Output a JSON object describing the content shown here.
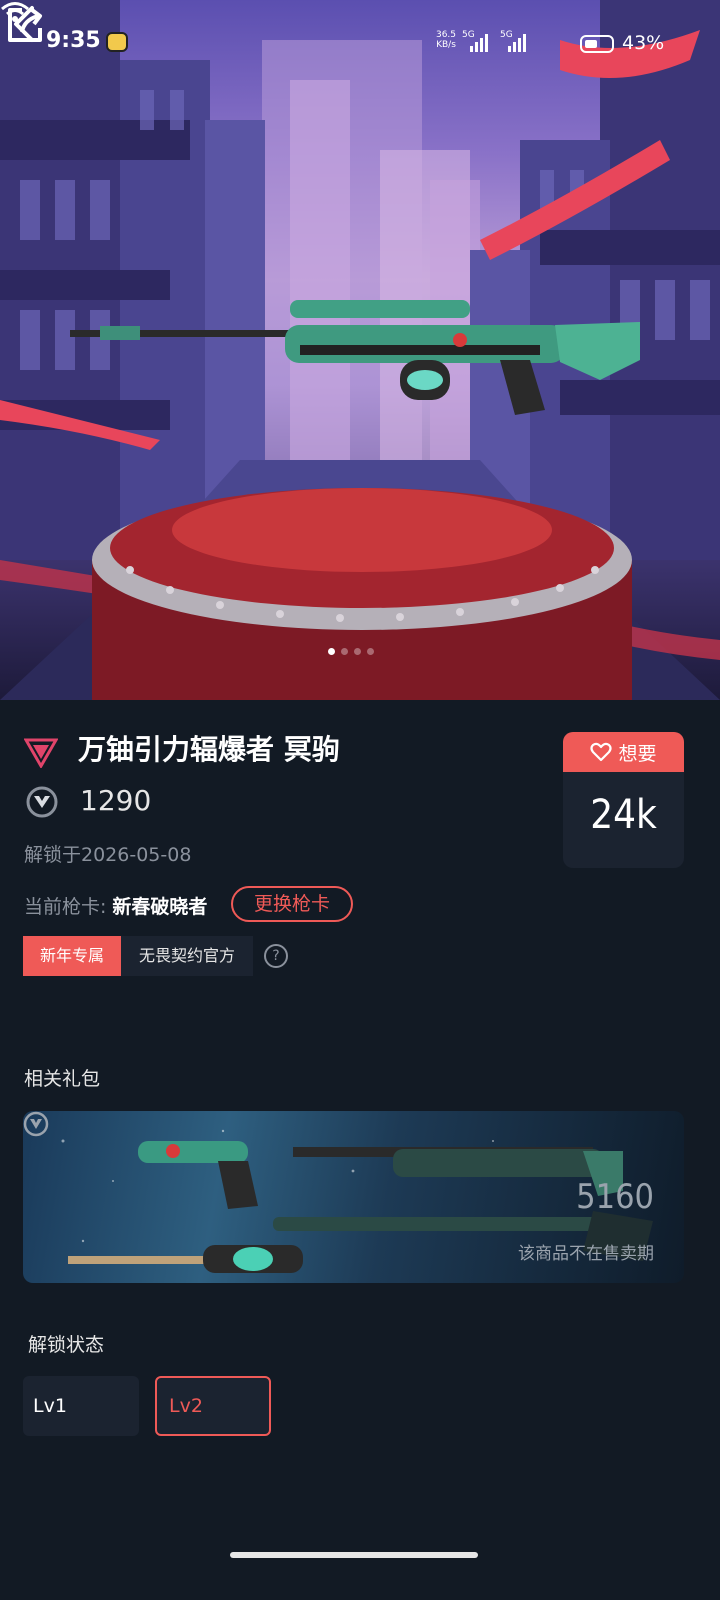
{
  "status_bar": {
    "time": "9:35",
    "net_speed_value": "36.5",
    "net_speed_unit": "KB/s",
    "signal1_label": "5G",
    "signal2_label": "5G",
    "battery": "43%"
  },
  "product": {
    "name": "万铀引力辐爆者 冥驹",
    "price": "1290",
    "unlock_date": "解锁于2026-05-08",
    "current_card_label": "当前枪卡:",
    "current_card_value": "新春破晓者",
    "change_card_button": "更换枪卡",
    "tags": [
      "新年专属",
      "无畏契约官方"
    ],
    "help": "?"
  },
  "want": {
    "label": "想要",
    "count": "24k"
  },
  "bundle": {
    "section_title": "相关礼包",
    "price": "5160",
    "status": "该商品不在售卖期"
  },
  "unlock_status": {
    "section_title": "解锁状态",
    "levels": [
      "Lv1",
      "Lv2"
    ],
    "selected": "Lv2"
  },
  "carousel": {
    "page_count": 4,
    "current_page": 1
  },
  "colors": {
    "accent": "#ef5a57",
    "background": "#121a24",
    "card": "#1b2330"
  }
}
